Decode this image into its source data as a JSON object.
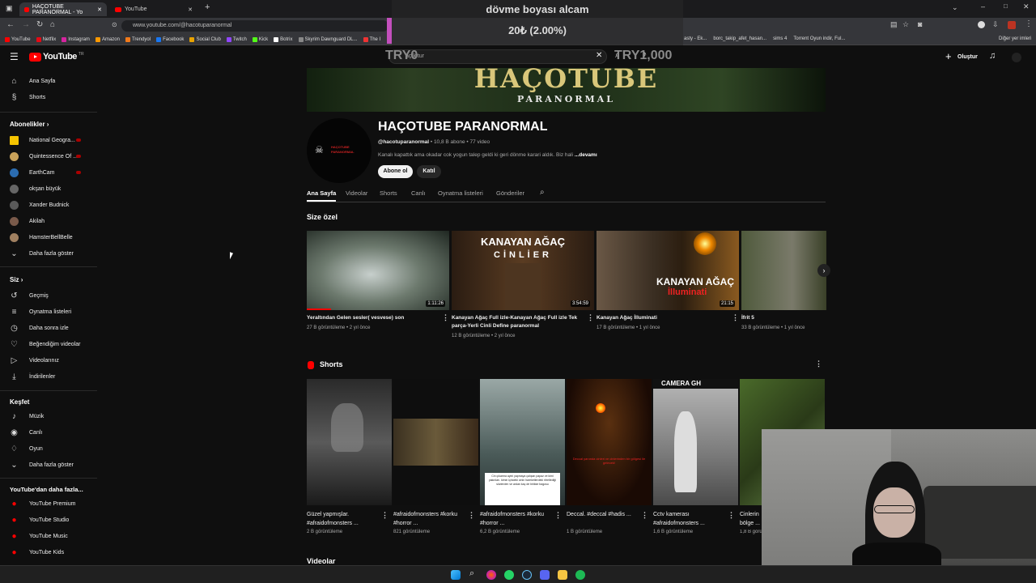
{
  "browser": {
    "tabs": [
      {
        "label": "HAÇOTUBE PARANORMAL - Yo"
      },
      {
        "label": "YouTube"
      }
    ],
    "url": "www.youtube.com/@hacotuparanormal",
    "bookmarks": [
      "YouTube",
      "Netflix",
      "Instagram",
      "Amazon",
      "Trendyol",
      "Facebook",
      "Social Club",
      "Twitch",
      "Kick",
      "Botrix",
      "Skyrim Dawnguard DL...",
      "The I"
    ],
    "bookmarks_right": [
      "asty - Ek...",
      "borc_takip_afet_hasan...",
      "sims 4",
      "Torrent Oyun indir, Ful..."
    ],
    "other_bookmarks": "Diğer yer imleri"
  },
  "donation_overlay": {
    "title": "dövme boyası alcam",
    "progress_text": "20₺ (2.00%)",
    "progress_fraction": 0.02,
    "min_label": "TRY0",
    "max_label": "TRY1,000"
  },
  "header": {
    "logo": "YouTube",
    "logo_country": "TR",
    "search_value": "açık tur",
    "create_label": "Oluştur"
  },
  "sidebar": {
    "main": [
      {
        "label": "Ana Sayfa",
        "icon": "home-icon"
      },
      {
        "label": "Shorts",
        "icon": "shorts-icon"
      }
    ],
    "subs_title": "Abonelikler",
    "subs": [
      {
        "label": "National Geogra...",
        "color": "#f5c400",
        "live": true
      },
      {
        "label": "Quintessence Of ...",
        "color": "#c9a25a",
        "live": true
      },
      {
        "label": "EarthCam",
        "color": "#2b6cb0",
        "live": true
      },
      {
        "label": "okşan büyük",
        "color": "#666666",
        "live": false
      },
      {
        "label": "Xander Budnick",
        "color": "#5a5a5a",
        "live": false
      },
      {
        "label": "Akilah",
        "color": "#7a5a4a",
        "live": false
      },
      {
        "label": "HamsterBellBelle",
        "color": "#a08060",
        "live": false
      }
    ],
    "subs_more": "Daha fazla göster",
    "you_title": "Siz",
    "you": [
      {
        "label": "Geçmiş",
        "icon": "history-icon"
      },
      {
        "label": "Oynatma listeleri",
        "icon": "playlist-icon"
      },
      {
        "label": "Daha sonra izle",
        "icon": "clock-icon"
      },
      {
        "label": "Beğendiğim videolar",
        "icon": "thumbs-up-icon"
      },
      {
        "label": "Videolarınız",
        "icon": "video-icon"
      },
      {
        "label": "İndirilenler",
        "icon": "download-icon"
      }
    ],
    "explore_title": "Keşfet",
    "explore": [
      {
        "label": "Müzik",
        "icon": "music-icon"
      },
      {
        "label": "Canlı",
        "icon": "live-icon"
      },
      {
        "label": "Oyun",
        "icon": "gamepad-icon"
      },
      {
        "label": "Daha fazla göster",
        "icon": "chevron-down-icon"
      }
    ],
    "more_title": "YouTube'dan daha fazla...",
    "more": [
      {
        "label": "YouTube Premium"
      },
      {
        "label": "YouTube Studio"
      },
      {
        "label": "YouTube Music"
      },
      {
        "label": "YouTube Kids"
      }
    ]
  },
  "channel": {
    "banner_title": "HAÇOTUBE",
    "banner_sub": "PARANORMAL",
    "name": "HAÇOTUBE PARANORMAL",
    "handle": "@hacotuparanormal",
    "subs": "10,8 B abone",
    "videos": "77 video",
    "description": "Kanalı kapattık ama okadar cok yogun talep geldi ki geri dönme karari aldık. Biz hali",
    "more_link": "...devamı",
    "subscribe": "Abone ol",
    "join": "Katıl",
    "avatar_text": "HAÇOTUBE PARANORMAL"
  },
  "channel_tabs": [
    "Ana Sayfa",
    "Videolar",
    "Shorts",
    "Canlı",
    "Oynatma listeleri",
    "Gönderiler"
  ],
  "for_you": {
    "title": "Size özel",
    "videos": [
      {
        "title": "Yeraltından Gelen sesler( vesvese) son",
        "meta": "27 B görüntüleme • 2 yıl önce",
        "duration": "1:11:26",
        "color": "#6d7a6e"
      },
      {
        "title": "Kanayan Ağaç Full izle-Kanayan Ağaç Full izle Tek parça-Yerli Cinli Define paranormal",
        "meta": "12 B görüntüleme • 2 yıl önce",
        "duration": "3:54:59",
        "color": "#3b2a1d",
        "overlay_top": "KANAYAN AĞAÇ",
        "overlay_bottom": "CİNLİER"
      },
      {
        "title": "Kanayan Ağaç İlluminati",
        "meta": "17 B görüntüleme • 1 yıl önce",
        "duration": "21:15",
        "color": "#4a3a2a",
        "overlay_top": "KANAYAN AĞAÇ",
        "overlay_bottom": "İlluminati"
      },
      {
        "title": "İfrit 5",
        "meta": "33 B görüntüleme • 1 yıl önce",
        "duration": "",
        "color": "#4f5a3c"
      }
    ]
  },
  "shorts": {
    "title": "Shorts",
    "items": [
      {
        "title": "Güzel yapmışlar. #afraidofmonsters ...",
        "meta": "2 B görüntüleme",
        "color": "#3a3a3a"
      },
      {
        "title": "#afraidofmonsters #korku #horror ...",
        "meta": "821 görüntüleme",
        "color": "#1a1a1a"
      },
      {
        "title": "#afraidofmonsters #korku #horror ...",
        "meta": "6,2 B görüntüleme",
        "color": "#5a6b6a"
      },
      {
        "title": "Deccal. #deccal #hadis ...",
        "meta": "1 B görüntüleme",
        "color": "#2a1408"
      },
      {
        "title": "Cctv kamerası #afraidofmonsters ...",
        "meta": "1,6 B görüntüleme",
        "color": "#8a8a8a",
        "overlay_top": "CAMERA GH"
      },
      {
        "title": "Cinlerin bölge ...",
        "meta": "1,8 B görüntüleme",
        "color": "#3c5a2a"
      }
    ],
    "short3_caption": "Cin çıkarma ayini yapmaya çalışan papaz ve kimi yakınları. kimin içindeki cinin hareketlerdeki ritrellediği sözlerden ve ardan kaç de birikke bagosu",
    "short4_caption": "Deccal yanında cinleri ve cinlerinden bir gölgesi ile gelecek!"
  },
  "videos_section": "Videolar"
}
